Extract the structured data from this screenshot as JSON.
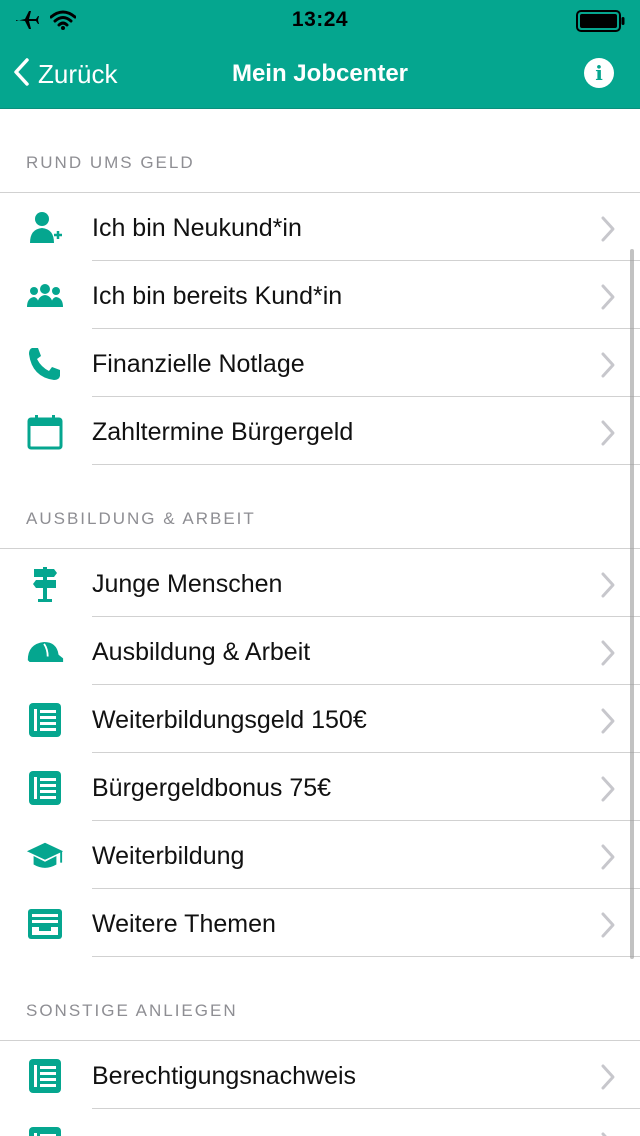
{
  "status": {
    "time": "13:24"
  },
  "nav": {
    "back_label": "Zurück",
    "title": "Mein Jobcenter",
    "info_glyph": "i"
  },
  "colors": {
    "accent": "#05a68f",
    "chevron": "#c7c7cc",
    "separator": "#d1d1d1",
    "section_text": "#8e8e93"
  },
  "sections": [
    {
      "header": "RUND UMS GELD",
      "items": [
        {
          "label": "Ich bin Neukund*in",
          "icon": "person-add-icon"
        },
        {
          "label": "Ich bin bereits Kund*in",
          "icon": "people-group-icon"
        },
        {
          "label": "Finanzielle Notlage",
          "icon": "phone-icon"
        },
        {
          "label": "Zahltermine Bürgergeld",
          "icon": "calendar-icon"
        }
      ]
    },
    {
      "header": "AUSBILDUNG & ARBEIT",
      "items": [
        {
          "label": "Junge Menschen",
          "icon": "signpost-icon"
        },
        {
          "label": "Ausbildung & Arbeit",
          "icon": "hard-hat-icon"
        },
        {
          "label": "Weiterbildungsgeld 150€",
          "icon": "document-list-icon"
        },
        {
          "label": "Bürgergeldbonus 75€",
          "icon": "document-list-icon"
        },
        {
          "label": "Weiterbildung",
          "icon": "graduation-cap-icon"
        },
        {
          "label": "Weitere Themen",
          "icon": "tray-icon"
        }
      ]
    },
    {
      "header": "SONSTIGE ANLIEGEN",
      "items": [
        {
          "label": "Berechtigungsnachweis",
          "icon": "document-list-icon"
        },
        {
          "label": "",
          "icon": "document-list-icon"
        }
      ]
    }
  ]
}
